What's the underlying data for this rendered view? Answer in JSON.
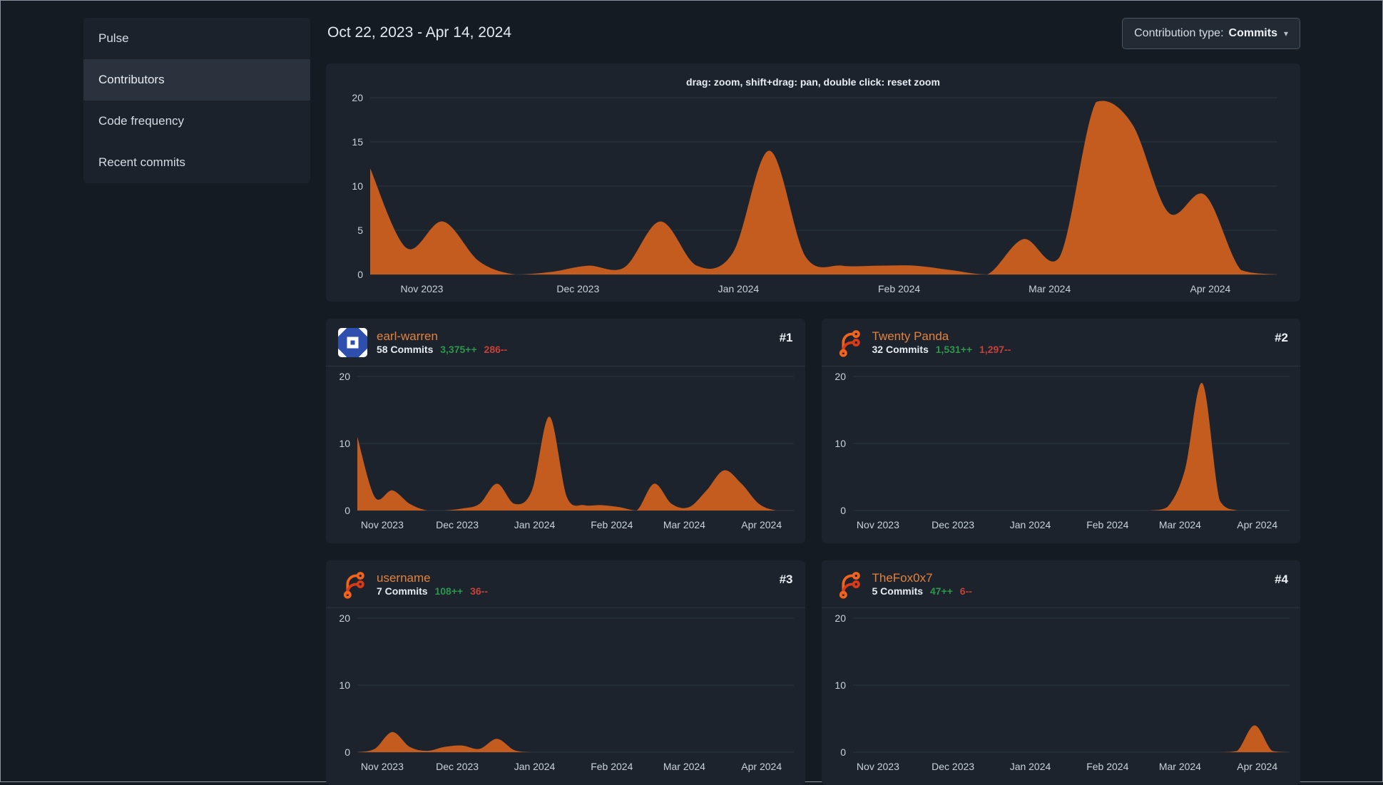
{
  "sidebar": {
    "items": [
      {
        "label": "Pulse",
        "active": false
      },
      {
        "label": "Contributors",
        "active": true
      },
      {
        "label": "Code frequency",
        "active": false
      },
      {
        "label": "Recent commits",
        "active": false
      }
    ]
  },
  "header": {
    "date_range": "Oct 22, 2023 - Apr 14, 2024",
    "contribution_type": {
      "label": "Contribution type:",
      "value": "Commits"
    }
  },
  "icons": {
    "caret_down": "▾"
  },
  "overview": {
    "hint": "drag: zoom, shift+drag: pan, double click: reset zoom"
  },
  "contributors": [
    {
      "rank": "#1",
      "name": "earl-warren",
      "commits": "58 Commits",
      "additions": "3,375++",
      "deletions": "286--",
      "avatar": "identicon"
    },
    {
      "rank": "#2",
      "name": "Twenty Panda",
      "commits": "32 Commits",
      "additions": "1,531++",
      "deletions": "1,297--",
      "avatar": "forgejo"
    },
    {
      "rank": "#3",
      "name": "username",
      "commits": "7 Commits",
      "additions": "108++",
      "deletions": "36--",
      "avatar": "forgejo"
    },
    {
      "rank": "#4",
      "name": "TheFox0x7",
      "commits": "5 Commits",
      "additions": "47++",
      "deletions": "6--",
      "avatar": "forgejo"
    }
  ],
  "colors": {
    "area": "#c35c1e",
    "grid": "#2c3440",
    "tick_text": "#c9d1d9",
    "green": "#2c974b",
    "red": "#c6403a",
    "name_link": "#e2823d"
  },
  "chart_data": [
    {
      "type": "area",
      "title": "Overall commit activity",
      "x_unit": "week",
      "x_range": [
        "Oct 22, 2023",
        "Apr 14, 2024"
      ],
      "ylim": [
        0,
        20
      ],
      "y_ticks": [
        0,
        5,
        10,
        15,
        20
      ],
      "x_tick_labels": [
        "Nov 2023",
        "Dec 2023",
        "Jan 2024",
        "Feb 2024",
        "Mar 2024",
        "Apr 2024"
      ],
      "x_tick_fractions": [
        0.057,
        0.229,
        0.406,
        0.583,
        0.749,
        0.926
      ],
      "values": [
        12,
        3,
        6,
        1.5,
        0,
        0.3,
        1,
        0.8,
        6,
        1,
        2.5,
        14,
        2,
        1,
        1,
        1,
        0.5,
        0,
        4,
        2,
        19.5,
        17,
        7,
        9,
        0.5,
        0
      ]
    },
    {
      "type": "area",
      "contributor": "earl-warren",
      "x_unit": "week",
      "ylim": [
        0,
        20
      ],
      "y_ticks": [
        0,
        10,
        20
      ],
      "x_tick_labels": [
        "Nov 2023",
        "Dec 2023",
        "Jan 2024",
        "Feb 2024",
        "Mar 2024",
        "Apr 2024"
      ],
      "x_tick_fractions": [
        0.057,
        0.229,
        0.406,
        0.583,
        0.749,
        0.926
      ],
      "values": [
        11,
        2,
        3,
        1,
        0,
        0,
        0.3,
        1,
        4,
        1,
        3,
        14,
        2,
        0.8,
        0.8,
        0.5,
        0,
        4,
        1,
        0.5,
        3,
        6,
        4,
        1,
        0,
        0
      ]
    },
    {
      "type": "area",
      "contributor": "Twenty Panda",
      "x_unit": "week",
      "ylim": [
        0,
        20
      ],
      "y_ticks": [
        0,
        10,
        20
      ],
      "x_tick_labels": [
        "Nov 2023",
        "Dec 2023",
        "Jan 2024",
        "Feb 2024",
        "Mar 2024",
        "Apr 2024"
      ],
      "x_tick_fractions": [
        0.057,
        0.229,
        0.406,
        0.583,
        0.749,
        0.926
      ],
      "values": [
        0,
        0,
        0,
        0,
        0,
        0,
        0,
        0,
        0,
        0,
        0,
        0,
        0,
        0,
        0,
        0,
        0,
        0,
        0.5,
        6,
        19,
        1.5,
        0,
        0,
        0,
        0
      ]
    },
    {
      "type": "area",
      "contributor": "username",
      "x_unit": "week",
      "ylim": [
        0,
        20
      ],
      "y_ticks": [
        0,
        10,
        20
      ],
      "x_tick_labels": [
        "Nov 2023",
        "Dec 2023",
        "Jan 2024",
        "Feb 2024",
        "Mar 2024",
        "Apr 2024"
      ],
      "x_tick_fractions": [
        0.057,
        0.229,
        0.406,
        0.583,
        0.749,
        0.926
      ],
      "values": [
        0,
        0.5,
        3,
        0.8,
        0.2,
        0.8,
        1,
        0.5,
        2,
        0.3,
        0,
        0,
        0,
        0,
        0,
        0,
        0,
        0,
        0,
        0,
        0,
        0,
        0,
        0,
        0,
        0
      ]
    },
    {
      "type": "area",
      "contributor": "TheFox0x7",
      "x_unit": "week",
      "ylim": [
        0,
        20
      ],
      "y_ticks": [
        0,
        10,
        20
      ],
      "x_tick_labels": [
        "Nov 2023",
        "Dec 2023",
        "Jan 2024",
        "Feb 2024",
        "Mar 2024",
        "Apr 2024"
      ],
      "x_tick_fractions": [
        0.057,
        0.229,
        0.406,
        0.583,
        0.749,
        0.926
      ],
      "values": [
        0,
        0,
        0,
        0,
        0,
        0,
        0,
        0,
        0,
        0,
        0,
        0,
        0,
        0,
        0,
        0,
        0,
        0,
        0,
        0,
        0,
        0,
        0.2,
        4,
        0.2,
        0
      ]
    }
  ]
}
